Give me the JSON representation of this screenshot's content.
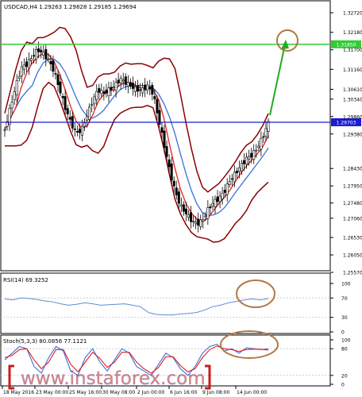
{
  "chart_data": [
    {
      "panel": "price",
      "type": "candlestick",
      "header": "USDCAD,H4  1.29263 1.29828 1.29185 1.29694",
      "ylim": [
        1.2557,
        1.3272
      ],
      "y_ticks": [
        "1.32720",
        "1.32180",
        "1.31700",
        "1.31160",
        "1.30610",
        "1.30340",
        "1.29860",
        "1.29380",
        "1.28430",
        "1.27950",
        "1.27480",
        "1.27060",
        "1.26530",
        "1.26050",
        "1.25570"
      ],
      "hlines": [
        {
          "label": "1.31850",
          "value": 1.3185,
          "color": "#33cc33"
        },
        {
          "label": "1.29703",
          "value": 1.29703,
          "color": "#1c1cd0"
        }
      ],
      "price_path": [
        1.295,
        1.301,
        1.307,
        1.312,
        1.313,
        1.315,
        1.317,
        1.316,
        1.314,
        1.311,
        1.306,
        1.301,
        1.297,
        1.294,
        1.295,
        1.299,
        1.303,
        1.306,
        1.305,
        1.306,
        1.307,
        1.309,
        1.308,
        1.307,
        1.306,
        1.306,
        1.307,
        1.305,
        1.298,
        1.291,
        1.284,
        1.278,
        1.274,
        1.272,
        1.27,
        1.269,
        1.27,
        1.273,
        1.275,
        1.276,
        1.278,
        1.281,
        1.283,
        1.285,
        1.287,
        1.288,
        1.29,
        1.293,
        1.2969
      ],
      "annotations": [
        "green arrow up",
        "circle at target 1.3185"
      ]
    },
    {
      "panel": "rsi",
      "type": "line",
      "header": "RSI(14) 69.3252",
      "values": [
        68,
        66,
        70,
        69,
        67,
        64,
        62,
        58,
        55,
        57,
        60,
        58,
        55,
        56,
        57,
        58,
        55,
        52,
        40,
        36,
        35,
        35,
        37,
        38,
        40,
        45,
        52,
        55,
        60,
        63,
        66,
        68,
        66,
        69
      ],
      "y_ticks": [
        "100",
        "70",
        "30",
        "0"
      ],
      "ylim": [
        0,
        100
      ],
      "color": "#5b8fd0"
    },
    {
      "panel": "stochastic",
      "type": "line",
      "header": "Stoch(5,3,3) 80.0856 77.1121",
      "series": [
        {
          "values": [
            55,
            70,
            85,
            80,
            40,
            25,
            60,
            85,
            75,
            30,
            20,
            60,
            80,
            50,
            30,
            55,
            80,
            70,
            40,
            30,
            20,
            45,
            70,
            60,
            35,
            20,
            40,
            70,
            85,
            90,
            75,
            80,
            70,
            82,
            80,
            78,
            80
          ]
        },
        {
          "values": [
            60,
            65,
            78,
            80,
            55,
            35,
            50,
            78,
            78,
            45,
            28,
            50,
            72,
            58,
            38,
            50,
            72,
            72,
            50,
            35,
            25,
            38,
            62,
            62,
            42,
            28,
            35,
            60,
            78,
            86,
            80,
            78,
            74,
            78,
            79,
            79,
            77
          ]
        }
      ],
      "y_ticks": [
        "100",
        "80",
        "20",
        "0"
      ],
      "ylim": [
        0,
        100
      ]
    }
  ],
  "x_ticks": [
    "18 May 2016",
    "23 May 00:00",
    "25 May 16:00",
    "30 May 08:00",
    "2 Jun 00:00",
    "6 Jun 16:00",
    "9 Jun 08:00",
    "14 Jun 00:00"
  ],
  "watermark": "www.instaforex.com",
  "colors": {
    "bollinger": "#8b0000",
    "ma_red": "#e02020",
    "ma_blue": "#3a6fd8",
    "candle": "#000000",
    "level_green": "#33cc33",
    "level_blue": "#1c1cd0",
    "circle": "#b07848",
    "arrow": "#22aa22",
    "wm_red": "#c81d1d",
    "wm_blue": "#2a5aa8"
  }
}
